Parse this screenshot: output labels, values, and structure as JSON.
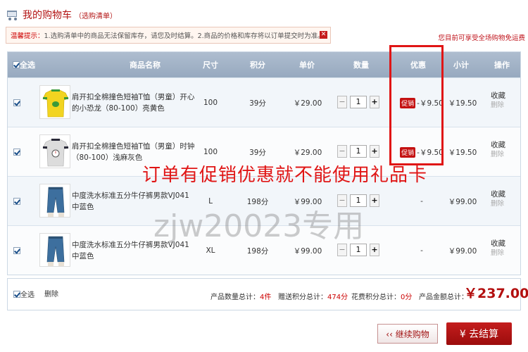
{
  "header": {
    "title": "我的购物车",
    "subtitle": "（选购清单）"
  },
  "notice": {
    "label": "温馨提示：",
    "text": "1.选购清单中的商品无法保留库存，请您及时结算。2.商品的价格和库存将以订单提交时为准。"
  },
  "shipping_notice": "您目前可享受全场购物免运费",
  "table": {
    "columns": [
      "全选",
      "商品名称",
      "尺寸",
      "积分",
      "单价",
      "数量",
      "优惠",
      "小计",
      "操作"
    ],
    "rows": [
      {
        "name": "肩开扣全棉撞色短袖T恤（男童）开心的小恐龙（80-100）亮黄色",
        "size": "100",
        "points": "39分",
        "price": "￥29.00",
        "qty": "1",
        "promo_badge": "促销",
        "discount": "-￥9.50",
        "subtotal": "￥19.50",
        "fav": "收藏",
        "del": "删除",
        "thumb": "yellow-tshirt"
      },
      {
        "name": "肩开扣全棉撞色短袖T恤（男童）时钟（80-100）浅麻灰色",
        "size": "100",
        "points": "39分",
        "price": "￥29.00",
        "qty": "1",
        "promo_badge": "促销",
        "discount": "-￥9.50",
        "subtotal": "￥19.50",
        "fav": "收藏",
        "del": "删除",
        "thumb": "grey-tshirt"
      },
      {
        "name": "中度洗水标准五分牛仔裤男款VJ041 中蓝色",
        "size": "L",
        "points": "198分",
        "price": "￥99.00",
        "qty": "1",
        "promo_badge": "",
        "discount": "-",
        "subtotal": "￥99.00",
        "fav": "收藏",
        "del": "删除",
        "thumb": "denim-shorts"
      },
      {
        "name": "中度洗水标准五分牛仔裤男款VJ041 中蓝色",
        "size": "XL",
        "points": "198分",
        "price": "￥99.00",
        "qty": "1",
        "promo_badge": "",
        "discount": "-",
        "subtotal": "￥99.00",
        "fav": "收藏",
        "del": "删除",
        "thumb": "denim-shorts"
      }
    ]
  },
  "footer": {
    "select_all": "全选",
    "delete": "删除",
    "count_label": "产品数量总计：",
    "count_value": "4件",
    "gift_points_label": "赠送积分总计：",
    "gift_points_value": "474分",
    "spent_points_label": "花费积分总计：",
    "spent_points_value": "0分",
    "amount_label": "产品金额总计：",
    "amount_value": "￥237.00"
  },
  "buttons": {
    "continue": "‹‹ 继续购物",
    "checkout": "¥  去结算"
  },
  "overlay_note": "订单有促销优惠就不能使用礼品卡",
  "watermark": "zjw20023专用",
  "colors": {
    "accent_red": "#c41111",
    "header_blue": "#a3b3c8"
  }
}
